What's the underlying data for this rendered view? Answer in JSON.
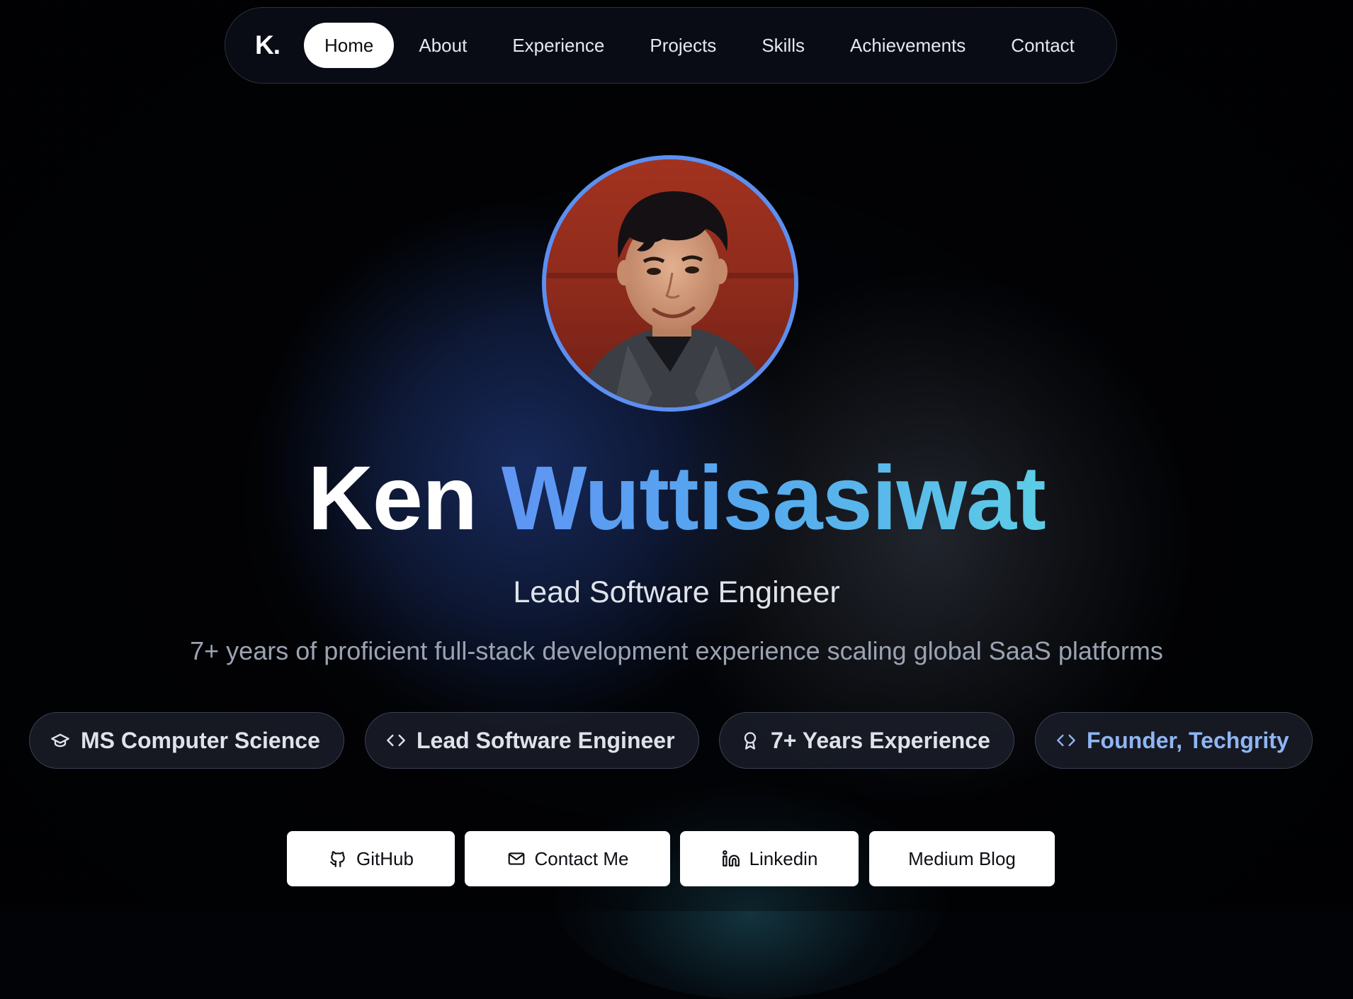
{
  "nav": {
    "brand": "K.",
    "links": [
      {
        "label": "Home",
        "active": true
      },
      {
        "label": "About",
        "active": false
      },
      {
        "label": "Experience",
        "active": false
      },
      {
        "label": "Projects",
        "active": false
      },
      {
        "label": "Skills",
        "active": false
      },
      {
        "label": "Achievements",
        "active": false
      },
      {
        "label": "Contact",
        "active": false
      }
    ]
  },
  "hero": {
    "first_name": "Ken",
    "last_name": "Wuttisasiwat",
    "role": "Lead Software Engineer",
    "tagline": "7+ years of proficient full-stack development experience scaling global SaaS platforms"
  },
  "badges": [
    {
      "icon": "graduation-cap-icon",
      "label": "MS Computer Science"
    },
    {
      "icon": "code-icon",
      "label": "Lead Software Engineer"
    },
    {
      "icon": "award-icon",
      "label": "7+ Years Experience"
    },
    {
      "icon": "code-icon",
      "label": "Founder, Techgrity"
    }
  ],
  "buttons": [
    {
      "icon": "github-icon",
      "label": "GitHub"
    },
    {
      "icon": "mail-icon",
      "label": "Contact Me"
    },
    {
      "icon": "linkedin-icon",
      "label": "Linkedin"
    },
    {
      "icon": "",
      "label": "Medium Blog"
    }
  ],
  "colors": {
    "background": "#020306",
    "accent_blue": "#5f95f4",
    "accent_cyan": "#5ccde6",
    "avatar_ring": "#5c8ff0",
    "badge_highlight": "#8fb5f4"
  }
}
